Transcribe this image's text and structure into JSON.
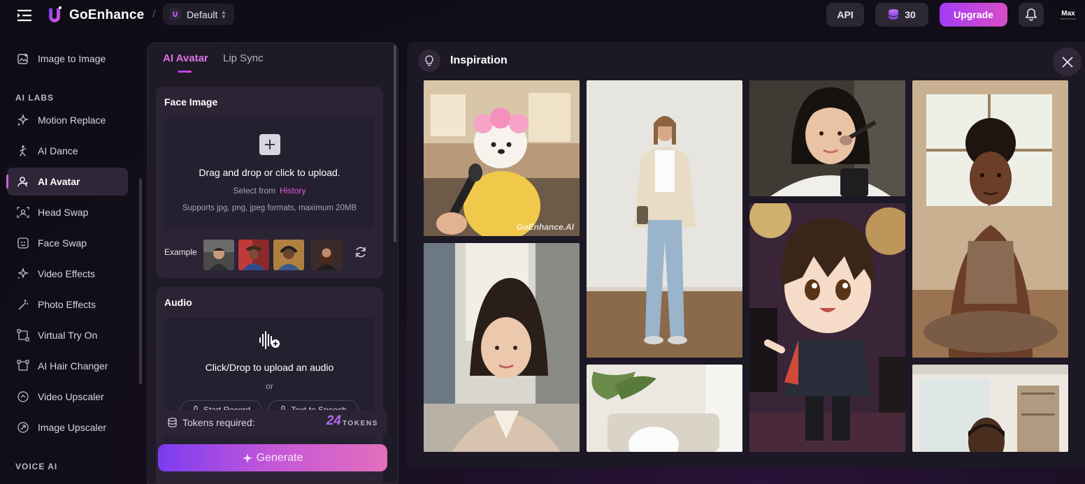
{
  "app": {
    "name": "GoEnhance",
    "workspace": "Default",
    "profile_name": "Max",
    "profile_sub": "PRODUCTIONS"
  },
  "topbar": {
    "api_label": "API",
    "credits": "30",
    "upgrade_label": "Upgrade"
  },
  "sidebar": {
    "items_top": [
      {
        "label": "Image to Image",
        "icon": "image-icon"
      }
    ],
    "section_ai_labs": "AI LABS",
    "items_labs": [
      {
        "label": "Motion Replace",
        "icon": "sparkle-icon"
      },
      {
        "label": "AI Dance",
        "icon": "dance-icon"
      },
      {
        "label": "AI Avatar",
        "icon": "avatar-icon",
        "active": true
      },
      {
        "label": "Head Swap",
        "icon": "head-swap-icon"
      },
      {
        "label": "Face Swap",
        "icon": "face-swap-icon"
      },
      {
        "label": "Video Effects",
        "icon": "sparkle-icon"
      },
      {
        "label": "Photo Effects",
        "icon": "wand-icon"
      },
      {
        "label": "Virtual Try On",
        "icon": "frame-icon"
      },
      {
        "label": "AI Hair Changer",
        "icon": "frame-icon"
      },
      {
        "label": "Video Upscaler",
        "icon": "upscale-icon"
      },
      {
        "label": "Image Upscaler",
        "icon": "upscale-icon"
      }
    ],
    "section_voice_ai": "VOICE AI"
  },
  "panel": {
    "tabs": [
      {
        "label": "AI Avatar",
        "active": true
      },
      {
        "label": "Lip Sync",
        "active": false
      }
    ],
    "face": {
      "title": "Face Image",
      "drop_title": "Drag and drop or click to upload.",
      "select_from": "Select from",
      "history_link": "History",
      "formats": "Supports jpg, png, jpeg formats, maximum 20MB",
      "example_label": "Example"
    },
    "audio": {
      "title": "Audio",
      "drop_title": "Click/Drop to upload an audio",
      "or": "or",
      "start_record": "Start Record",
      "text_to_speech": "Text to Speech"
    },
    "tokens": {
      "label": "Tokens required:",
      "count": "24",
      "unit": "TOKENS"
    },
    "generate_label": "Generate"
  },
  "inspiration": {
    "title": "Inspiration",
    "watermark": "GoEnhance.AI",
    "tiles": [
      {
        "name": "tile-dog-salon"
      },
      {
        "name": "tile-woman-city"
      },
      {
        "name": "tile-woman-jeans"
      },
      {
        "name": "tile-living-room"
      },
      {
        "name": "tile-woman-makeup"
      },
      {
        "name": "tile-anime-singer"
      },
      {
        "name": "tile-woman-yoga"
      },
      {
        "name": "tile-man-office"
      }
    ]
  },
  "colors": {
    "accent": "#d873e6",
    "brand_gradient_start": "#a33cf5",
    "brand_gradient_end": "#d84ec7",
    "background": "#140f1c"
  }
}
